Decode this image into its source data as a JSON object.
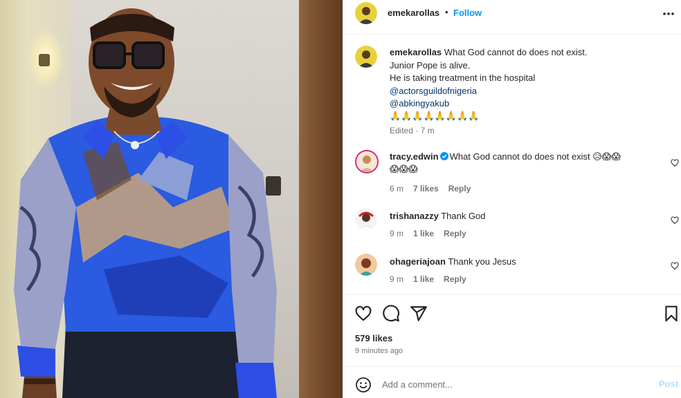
{
  "post": {
    "username": "emekarollas",
    "follow_label": "Follow",
    "dot": "•",
    "caption_lines": [
      "What God cannot do does not exist.",
      "Junior Pope is alive.",
      "He is taking treatment in the hospital"
    ],
    "mentions": [
      "@actorsguildofnigeria",
      "@abkingyakub"
    ],
    "emoji_line": "🙏🙏🙏🙏🙏🙏🙏🙏",
    "edited": "Edited · 7 m"
  },
  "comments": [
    {
      "username": "tracy.edwin",
      "verified": true,
      "text": "What God cannot do does not exist 😥😱😱",
      "text_line2": "😱😱😱",
      "time": "6 m",
      "likes": "7 likes",
      "reply": "Reply"
    },
    {
      "username": "trishanazzy",
      "text": "Thank God",
      "time": "9 m",
      "likes": "1 like",
      "reply": "Reply"
    },
    {
      "username": "ohageriajoan",
      "text": "Thank you Jesus",
      "time": "9 m",
      "likes": "1 like",
      "reply": "Reply"
    }
  ],
  "engagement": {
    "likes": "579 likes",
    "time_ago": "9 minutes ago"
  },
  "comment_box": {
    "placeholder": "Add a comment...",
    "post_label": "Post"
  },
  "icons": {
    "like": "heart-icon",
    "comment": "comment-icon",
    "share": "share-icon",
    "save": "bookmark-icon",
    "more": "more-horizontal-icon",
    "emoji": "emoji-icon"
  },
  "colors": {
    "accent": "#0095f6",
    "mention": "#00376b",
    "secondary_text": "#737373",
    "post_disabled": "#b3dbff"
  }
}
